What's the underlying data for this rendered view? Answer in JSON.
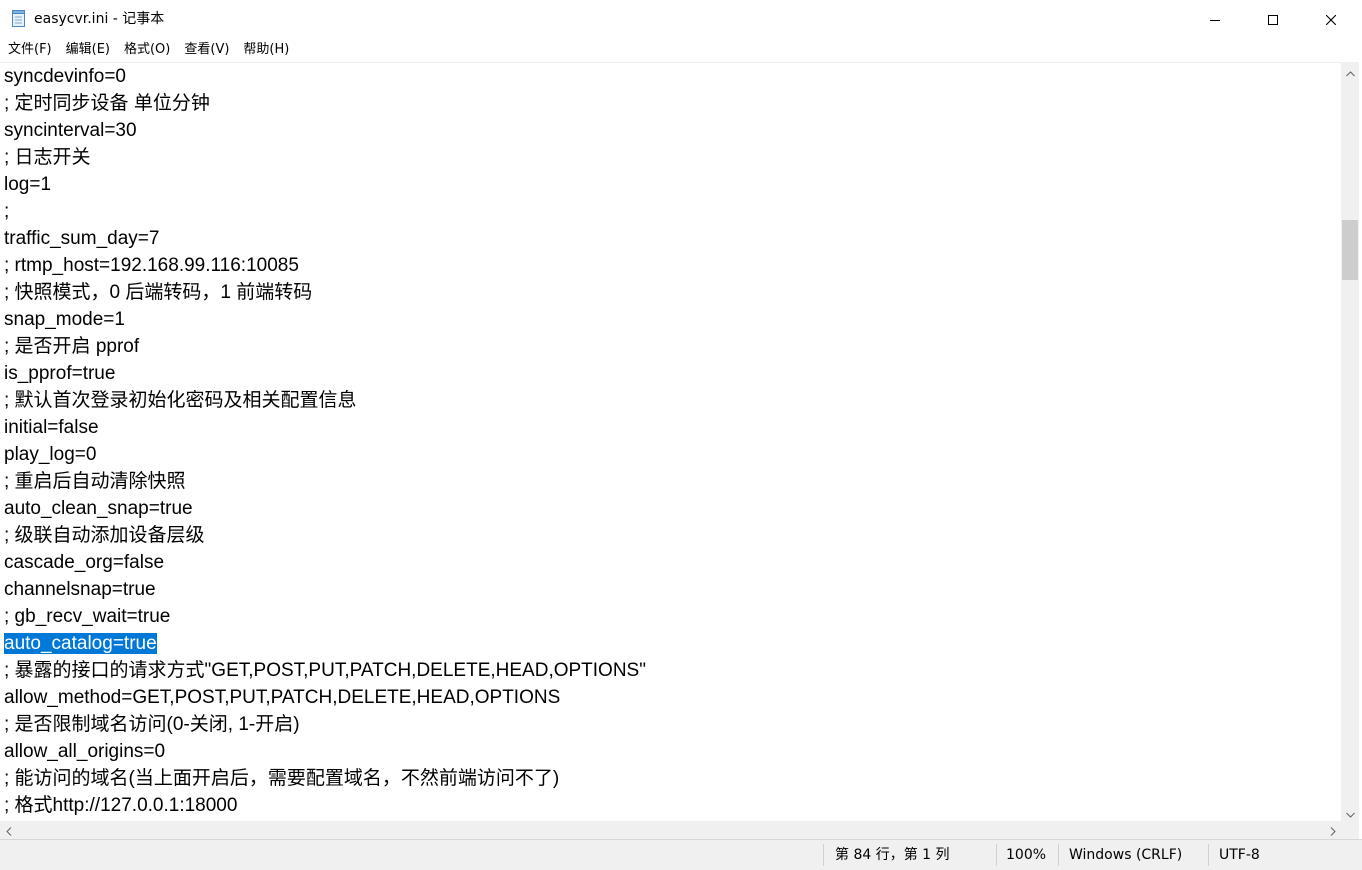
{
  "window": {
    "title": "easycvr.ini - 记事本",
    "icon": "notepad-icon"
  },
  "menu": {
    "items": [
      {
        "label": "文件(F)"
      },
      {
        "label": "编辑(E)"
      },
      {
        "label": "格式(O)"
      },
      {
        "label": "查看(V)"
      },
      {
        "label": "帮助(H)"
      }
    ]
  },
  "editor": {
    "lines": [
      "syncdevinfo=0",
      "; 定时同步设备 单位分钟",
      "syncinterval=30",
      "; 日志开关",
      "log=1",
      ";",
      "traffic_sum_day=7",
      "; rtmp_host=192.168.99.116:10085",
      "; 快照模式，0 后端转码，1 前端转码",
      "snap_mode=1",
      "; 是否开启 pprof",
      "is_pprof=true",
      "; 默认首次登录初始化密码及相关配置信息",
      "initial=false",
      "play_log=0",
      "; 重启后自动清除快照",
      "auto_clean_snap=true",
      "; 级联自动添加设备层级",
      "cascade_org=false",
      "channelsnap=true",
      "; gb_recv_wait=true",
      "auto_catalog=true",
      "; 暴露的接口的请求方式\"GET,POST,PUT,PATCH,DELETE,HEAD,OPTIONS\"",
      "allow_method=GET,POST,PUT,PATCH,DELETE,HEAD,OPTIONS",
      "; 是否限制域名访问(0-关闭, 1-开启)",
      "allow_all_origins=0",
      "; 能访问的域名(当上面开启后，需要配置域名，不然前端访问不了)",
      "; 格式http://127.0.0.1:18000"
    ],
    "selected_line_index": 21
  },
  "status": {
    "position": "第 84 行，第 1 列",
    "zoom": "100%",
    "line_ending": "Windows (CRLF)",
    "encoding": "UTF-8"
  },
  "colors": {
    "selection": "#0078d7",
    "chrome": "#f0f0f0"
  }
}
